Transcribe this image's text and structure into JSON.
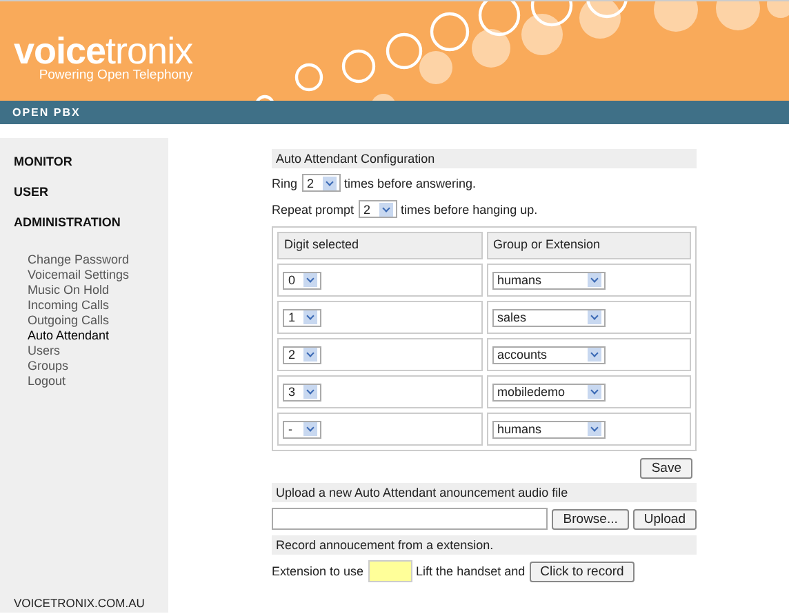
{
  "header": {
    "logo": "**voice**tronix",
    "tagline": "Powering Open Telephony"
  },
  "nav_bar": {
    "title": "OPEN PBX"
  },
  "sidebar": {
    "sections": [
      {
        "label": "MONITOR"
      },
      {
        "label": "USER"
      },
      {
        "label": "ADMINISTRATION"
      }
    ],
    "links": [
      {
        "label": "Change Password",
        "selected": false
      },
      {
        "label": "Voicemail Settings",
        "selected": false
      },
      {
        "label": "Music On Hold",
        "selected": false
      },
      {
        "label": "Incoming Calls",
        "selected": false
      },
      {
        "label": "Outgoing Calls",
        "selected": false
      },
      {
        "label": "Auto Attendant",
        "selected": true
      },
      {
        "label": "Users",
        "selected": false
      },
      {
        "label": "Groups",
        "selected": false
      },
      {
        "label": "Logout",
        "selected": false
      }
    ],
    "footer": "VOICETRONIX.COM.AU"
  },
  "config": {
    "title": "Auto Attendant Configuration",
    "ring": {
      "prefix": "Ring",
      "value": "2",
      "suffix": "times before answering."
    },
    "repeat": {
      "prefix": "Repeat prompt",
      "value": "2",
      "suffix": "times before hanging up."
    },
    "columns": [
      "Digit selected",
      "Group or Extension"
    ],
    "rows": [
      {
        "digit": "0",
        "target": "humans"
      },
      {
        "digit": "1",
        "target": "sales"
      },
      {
        "digit": "2",
        "target": "accounts"
      },
      {
        "digit": "3",
        "target": "mobiledemo"
      },
      {
        "digit": "-",
        "target": "humans"
      }
    ],
    "save_button": "Save"
  },
  "upload": {
    "title": "Upload a new Auto Attendant anouncement audio file",
    "browse_button": "Browse...",
    "upload_button": "Upload"
  },
  "record": {
    "title": "Record annoucement from a extension.",
    "extension_label": "Extension to use",
    "lift_text": "Lift the handset and",
    "record_button": "Click to record"
  }
}
